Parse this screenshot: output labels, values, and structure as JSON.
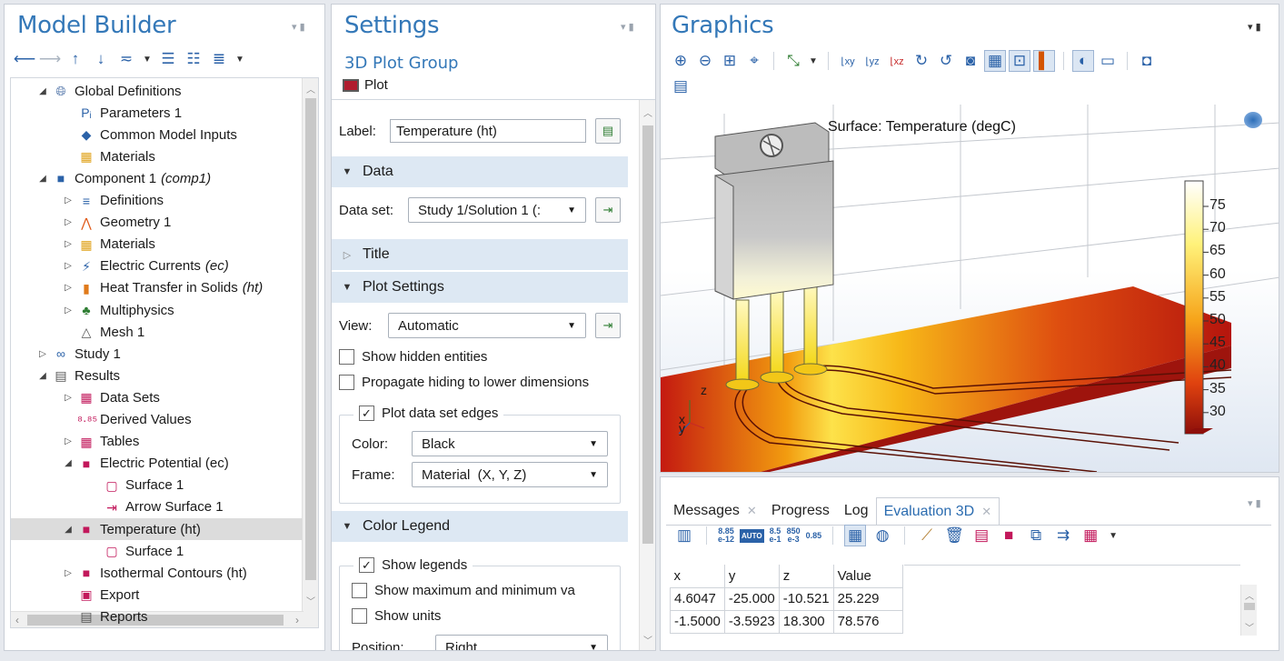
{
  "model_builder": {
    "title": "Model Builder",
    "tree": [
      {
        "label": "Global Definitions",
        "suffix": "",
        "level": 1,
        "toggle": "◢",
        "icon": "globe-icon"
      },
      {
        "label": "Parameters 1",
        "suffix": "",
        "level": 2,
        "toggle": "",
        "icon": "parameters-icon"
      },
      {
        "label": "Common Model Inputs",
        "suffix": "",
        "level": 2,
        "toggle": "",
        "icon": "model-inputs-icon"
      },
      {
        "label": "Materials",
        "suffix": "",
        "level": 2,
        "toggle": "",
        "icon": "materials-icon"
      },
      {
        "label": "Component 1",
        "suffix": "(comp1)",
        "level": 1,
        "toggle": "◢",
        "icon": "component-icon"
      },
      {
        "label": "Definitions",
        "suffix": "",
        "level": 2,
        "toggle": "▷",
        "icon": "definitions-icon"
      },
      {
        "label": "Geometry 1",
        "suffix": "",
        "level": 2,
        "toggle": "▷",
        "icon": "geometry-icon"
      },
      {
        "label": "Materials",
        "suffix": "",
        "level": 2,
        "toggle": "▷",
        "icon": "materials-icon"
      },
      {
        "label": "Electric Currents",
        "suffix": "(ec)",
        "level": 2,
        "toggle": "▷",
        "icon": "electric-currents-icon"
      },
      {
        "label": "Heat Transfer in Solids",
        "suffix": "(ht)",
        "level": 2,
        "toggle": "▷",
        "icon": "heat-transfer-icon"
      },
      {
        "label": "Multiphysics",
        "suffix": "",
        "level": 2,
        "toggle": "▷",
        "icon": "multiphysics-icon"
      },
      {
        "label": "Mesh 1",
        "suffix": "",
        "level": 2,
        "toggle": "",
        "icon": "mesh-icon"
      },
      {
        "label": "Study 1",
        "suffix": "",
        "level": 1,
        "toggle": "▷",
        "icon": "study-icon"
      },
      {
        "label": "Results",
        "suffix": "",
        "level": 1,
        "toggle": "◢",
        "icon": "results-icon"
      },
      {
        "label": "Data Sets",
        "suffix": "",
        "level": 2,
        "toggle": "▷",
        "icon": "datasets-icon"
      },
      {
        "label": "Derived Values",
        "suffix": "",
        "level": 2,
        "toggle": "",
        "icon": "derived-values-icon"
      },
      {
        "label": "Tables",
        "suffix": "",
        "level": 2,
        "toggle": "▷",
        "icon": "tables-icon"
      },
      {
        "label": "Electric Potential (ec)",
        "suffix": "",
        "level": 2,
        "toggle": "◢",
        "icon": "plot-group-icon"
      },
      {
        "label": "Surface 1",
        "suffix": "",
        "level": 3,
        "toggle": "",
        "icon": "surface-icon"
      },
      {
        "label": "Arrow Surface 1",
        "suffix": "",
        "level": 3,
        "toggle": "",
        "icon": "arrow-surface-icon"
      },
      {
        "label": "Temperature (ht)",
        "suffix": "",
        "level": 2,
        "toggle": "◢",
        "icon": "plot-group-icon",
        "selected": true
      },
      {
        "label": "Surface 1",
        "suffix": "",
        "level": 3,
        "toggle": "",
        "icon": "surface-icon"
      },
      {
        "label": "Isothermal Contours (ht)",
        "suffix": "",
        "level": 2,
        "toggle": "▷",
        "icon": "plot-group-icon"
      },
      {
        "label": "Export",
        "suffix": "",
        "level": 2,
        "toggle": "",
        "icon": "export-icon"
      },
      {
        "label": "Reports",
        "suffix": "",
        "level": 2,
        "toggle": "",
        "icon": "reports-icon"
      }
    ]
  },
  "settings": {
    "title": "Settings",
    "subtitle": "3D Plot Group",
    "plot_label": "Plot",
    "label_caption": "Label:",
    "label_value": "Temperature (ht)",
    "sections": {
      "data": "Data",
      "title": "Title",
      "plot_settings": "Plot Settings",
      "color_legend": "Color Legend"
    },
    "data_set_caption": "Data set:",
    "data_set_value": "Study 1/Solution 1 (:",
    "view_caption": "View:",
    "view_value": "Automatic",
    "show_hidden": "Show hidden entities",
    "propagate_hiding": "Propagate hiding to lower dimensions",
    "plot_edges": "Plot data set edges",
    "color_caption": "Color:",
    "color_value": "Black",
    "frame_caption": "Frame:",
    "frame_value": "Material  (X, Y, Z)",
    "show_legends": "Show legends",
    "show_maxmin": "Show maximum and minimum va",
    "show_units": "Show units",
    "position_caption": "Position:",
    "position_value": "Right"
  },
  "graphics": {
    "title": "Graphics",
    "plot_title": "Surface: Temperature (degC)",
    "legend_ticks": [
      "75",
      "70",
      "65",
      "60",
      "55",
      "50",
      "45",
      "40",
      "35",
      "30"
    ],
    "axis_z": "z",
    "axis_x": "x",
    "axis_y": "y"
  },
  "messages": {
    "tabs": [
      {
        "label": "Messages",
        "closable": true
      },
      {
        "label": "Progress",
        "closable": false
      },
      {
        "label": "Log",
        "closable": false
      },
      {
        "label": "Evaluation 3D",
        "closable": true,
        "active": true
      }
    ],
    "toolbar_text": {
      "num1_top": "8.85",
      "num1_bot": "e-12",
      "auto": "AUTO",
      "num2_top": "8.5",
      "num2_bot": "e-1",
      "num3_top": "850",
      "num3_bot": "e-3",
      "num4": "0.85"
    },
    "table": {
      "columns": [
        "x",
        "y",
        "z",
        "Value"
      ],
      "rows": [
        [
          "4.6047",
          "-25.000",
          "-10.521",
          "25.229"
        ],
        [
          "-1.5000",
          "-3.5923",
          "18.300",
          "78.576"
        ]
      ]
    }
  },
  "colors": {
    "accent": "#3478b8",
    "selection": "#dcdcdc",
    "section_bg": "#dde8f3"
  }
}
